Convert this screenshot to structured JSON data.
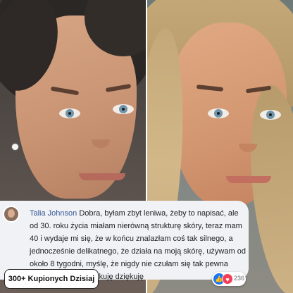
{
  "review": {
    "author": "Talia Johnson",
    "text": " Dobra, byłam zbyt leniwa, żeby to napisać, ale od 30. roku życia miałam nierówną strukturę skóry, teraz mam 40 i wydaje mi się, że w końcu znalazłam coś tak silnego, a jednocześnie delikatnego, że działa na moją skórę, używam od około 8 tygodni, myślę, że nigdy nie czułam się tak pewna siebie, dziękuję dziękuję dziękuję"
  },
  "reactions": {
    "count": "236",
    "icons": [
      "like-icon",
      "love-icon"
    ]
  },
  "badge": {
    "label": "300+ Kupionych Dzisiaj"
  },
  "colors": {
    "author_link": "#385898",
    "card_bg": "#f0f2f5",
    "like": "#1877f2",
    "love": "#f33e58"
  }
}
